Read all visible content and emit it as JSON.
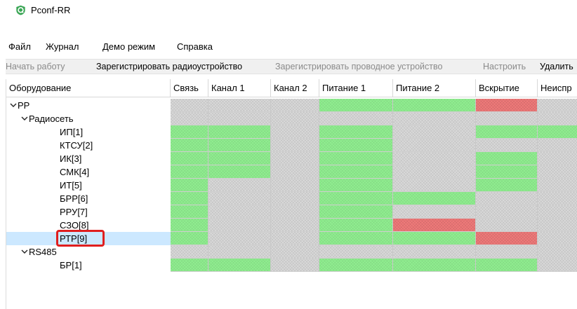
{
  "window": {
    "title": "Pconf-RR",
    "icon": "app-logo-icon"
  },
  "menu": [
    "Файл",
    "Журнал",
    "Демо режим",
    "Справка"
  ],
  "toolbar": [
    {
      "label": "Начать работу",
      "enabled": false
    },
    {
      "label": "Зарегистрировать радиоустройство",
      "enabled": true
    },
    {
      "label": "Зарегистрировать проводное устройство",
      "enabled": false
    },
    {
      "label": "Настроить",
      "enabled": false
    },
    {
      "label": "Удалить",
      "enabled": true
    }
  ],
  "table": {
    "columns": [
      "Оборудование",
      "Связь",
      "Канал 1",
      "Канал 2",
      "Питание 1",
      "Питание 2",
      "Вскрытие",
      "Неиспр"
    ],
    "status_colors": {
      "g": "#90ee90",
      "r": "#f07a7a",
      "x": "#d9d9d9"
    },
    "rows": [
      {
        "label": "РР",
        "level": 0,
        "expander": true,
        "states": [
          "x",
          "x",
          "x",
          "g",
          "g",
          "r",
          "x"
        ]
      },
      {
        "label": "Радиосеть",
        "level": 1,
        "expander": true,
        "states": [
          "x",
          "x",
          "x",
          "x",
          "x",
          "x",
          "x"
        ]
      },
      {
        "label": "ИП[1]",
        "level": 2,
        "states": [
          "g",
          "g",
          "x",
          "g",
          "x",
          "g",
          "g"
        ]
      },
      {
        "label": "КТСУ[2]",
        "level": 2,
        "states": [
          "g",
          "g",
          "x",
          "g",
          "x",
          "x",
          "x"
        ]
      },
      {
        "label": "ИК[3]",
        "level": 2,
        "states": [
          "g",
          "g",
          "x",
          "g",
          "x",
          "g",
          "x"
        ]
      },
      {
        "label": "СМК[4]",
        "level": 2,
        "states": [
          "g",
          "g",
          "x",
          "g",
          "x",
          "g",
          "x"
        ]
      },
      {
        "label": "ИТ[5]",
        "level": 2,
        "states": [
          "g",
          "x",
          "x",
          "g",
          "x",
          "g",
          "x"
        ]
      },
      {
        "label": "БРР[6]",
        "level": 2,
        "states": [
          "g",
          "x",
          "x",
          "g",
          "g",
          "x",
          "x"
        ]
      },
      {
        "label": "РРУ[7]",
        "level": 2,
        "states": [
          "g",
          "x",
          "x",
          "g",
          "x",
          "x",
          "x"
        ]
      },
      {
        "label": "СЗО[8]",
        "level": 2,
        "states": [
          "g",
          "x",
          "x",
          "g",
          "r",
          "x",
          "x"
        ]
      },
      {
        "label": "РТР[9]",
        "level": 2,
        "selected": true,
        "highlighted": true,
        "states": [
          "g",
          "x",
          "x",
          "g",
          "g",
          "r",
          "x"
        ]
      },
      {
        "label": "RS485",
        "level": 1,
        "expander": true,
        "states": [
          "x",
          "x",
          "x",
          "x",
          "x",
          "x",
          "x"
        ]
      },
      {
        "label": "БР[1]",
        "level": 2,
        "states": [
          "g",
          "g",
          "x",
          "g",
          "g",
          "g",
          "x"
        ]
      }
    ]
  }
}
